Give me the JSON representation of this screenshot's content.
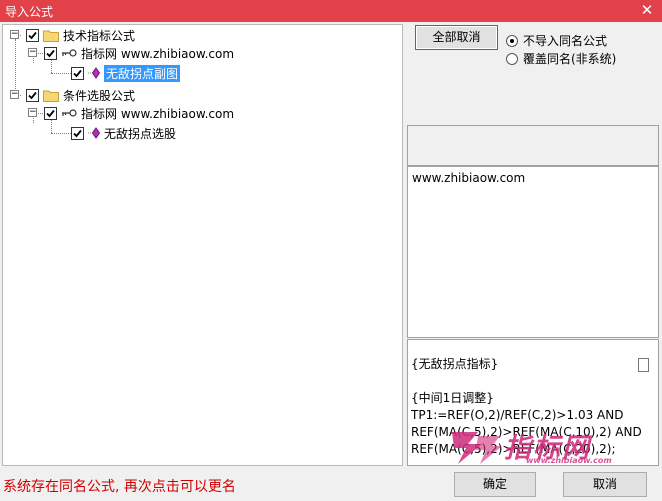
{
  "window": {
    "title": "导入公式",
    "close_glyph": "✕"
  },
  "tree": {
    "group1": {
      "label": "技术指标公式",
      "source": "指标网 www.zhibiaow.com",
      "item": "无敌拐点副图"
    },
    "group2": {
      "label": "条件选股公式",
      "source": "指标网 www.zhibiaow.com",
      "item": "无敌拐点选股"
    },
    "expander_glyph": "−"
  },
  "buttons": {
    "cancel_all": "全部取消",
    "ok": "确定",
    "cancel": "取消"
  },
  "options": {
    "no_import": "不导入同名公式",
    "overwrite": "覆盖同名(非系统)",
    "selected": "no_import"
  },
  "info": {
    "url": "www.zhibiaow.com"
  },
  "code_lines": [
    "{无敌拐点指标}",
    "",
    "{中间1日调整}",
    "TP1:=REF(O,2)/REF(C,2)>1.03 AND",
    "REF(MA(C,5),2)>REF(MA(C,10),2) AND",
    "REF(MA(C,5),2)>REF(MA(C,20),2);"
  ],
  "status": "系统存在同名公式, 再次点击可以更名",
  "watermark": {
    "brand": "指标网",
    "url": "www.zhibiaow.com"
  },
  "colors": {
    "titlebar": "#e3414a",
    "status_text": "#d00000",
    "selection": "#3399ff",
    "watermark": "#cf2b7c"
  }
}
